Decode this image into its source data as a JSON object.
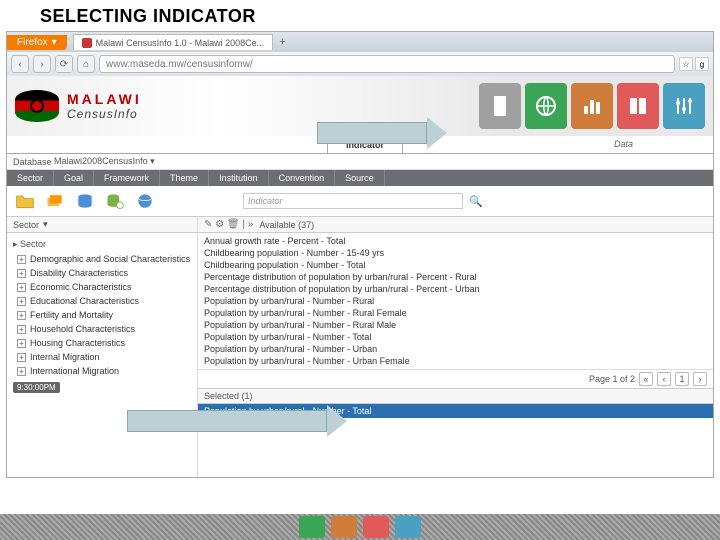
{
  "slide": {
    "title": "SELECTING INDICATOR"
  },
  "browser": {
    "firefox_label": "Firefox",
    "tab_title": "Malawi CensusInfo 1.0 - Malawi 2008Ce...",
    "tab_add": "+",
    "url": "www.maseda.mw/censusinfomw/",
    "nav": {
      "back": "‹",
      "fwd": "›",
      "reload": "⟳",
      "home": "⌂"
    }
  },
  "brand": {
    "line1": "MALAWI",
    "line2": "CensusInfo"
  },
  "top_tabs": {
    "indicator": "Indicator",
    "data": "Data"
  },
  "db": {
    "label": "Database",
    "value": "Malawi2008CensusInfo ▾"
  },
  "dims": [
    "Sector",
    "Goal",
    "Framework",
    "Theme",
    "Institution",
    "Convention",
    "Source"
  ],
  "search": {
    "placeholder": "Indicator",
    "icon": "🔍"
  },
  "sector": {
    "header": "Sector",
    "dropdown": "▾",
    "root": "Sector",
    "items": [
      "Demographic and Social Characteristics",
      "Disability Characteristics",
      "Economic Characteristics",
      "Educational Characteristics",
      "Fertility and Mortality",
      "Household Characteristics",
      "Housing Characteristics",
      "Internal Migration",
      "International Migration"
    ],
    "badge": "9:30:00PM"
  },
  "available": {
    "header": "Available (37)",
    "icons": "✎ ⚙ 🗑  | »",
    "items": [
      "Annual growth rate - Percent - Total",
      "Childbearing population - Number - 15-49 yrs",
      "Childbearing population - Number - Total",
      "Percentage distribution of population by urban/rural - Percent - Rural",
      "Percentage distribution of population by urban/rural - Percent - Urban",
      "Population by urban/rural - Number - Rural",
      "Population by urban/rural - Number - Rural Female",
      "Population by urban/rural - Number - Rural Male",
      "Population by urban/rural - Number - Total",
      "Population by urban/rural - Number - Urban",
      "Population by urban/rural - Number - Urban Female"
    ],
    "pager": {
      "text": "Page 1 of 2",
      "first": "«",
      "prev": "‹",
      "cur": "1",
      "next": "›"
    }
  },
  "selected": {
    "header": "Selected (1)",
    "item": "Population by urban/rural - Number - Total"
  }
}
